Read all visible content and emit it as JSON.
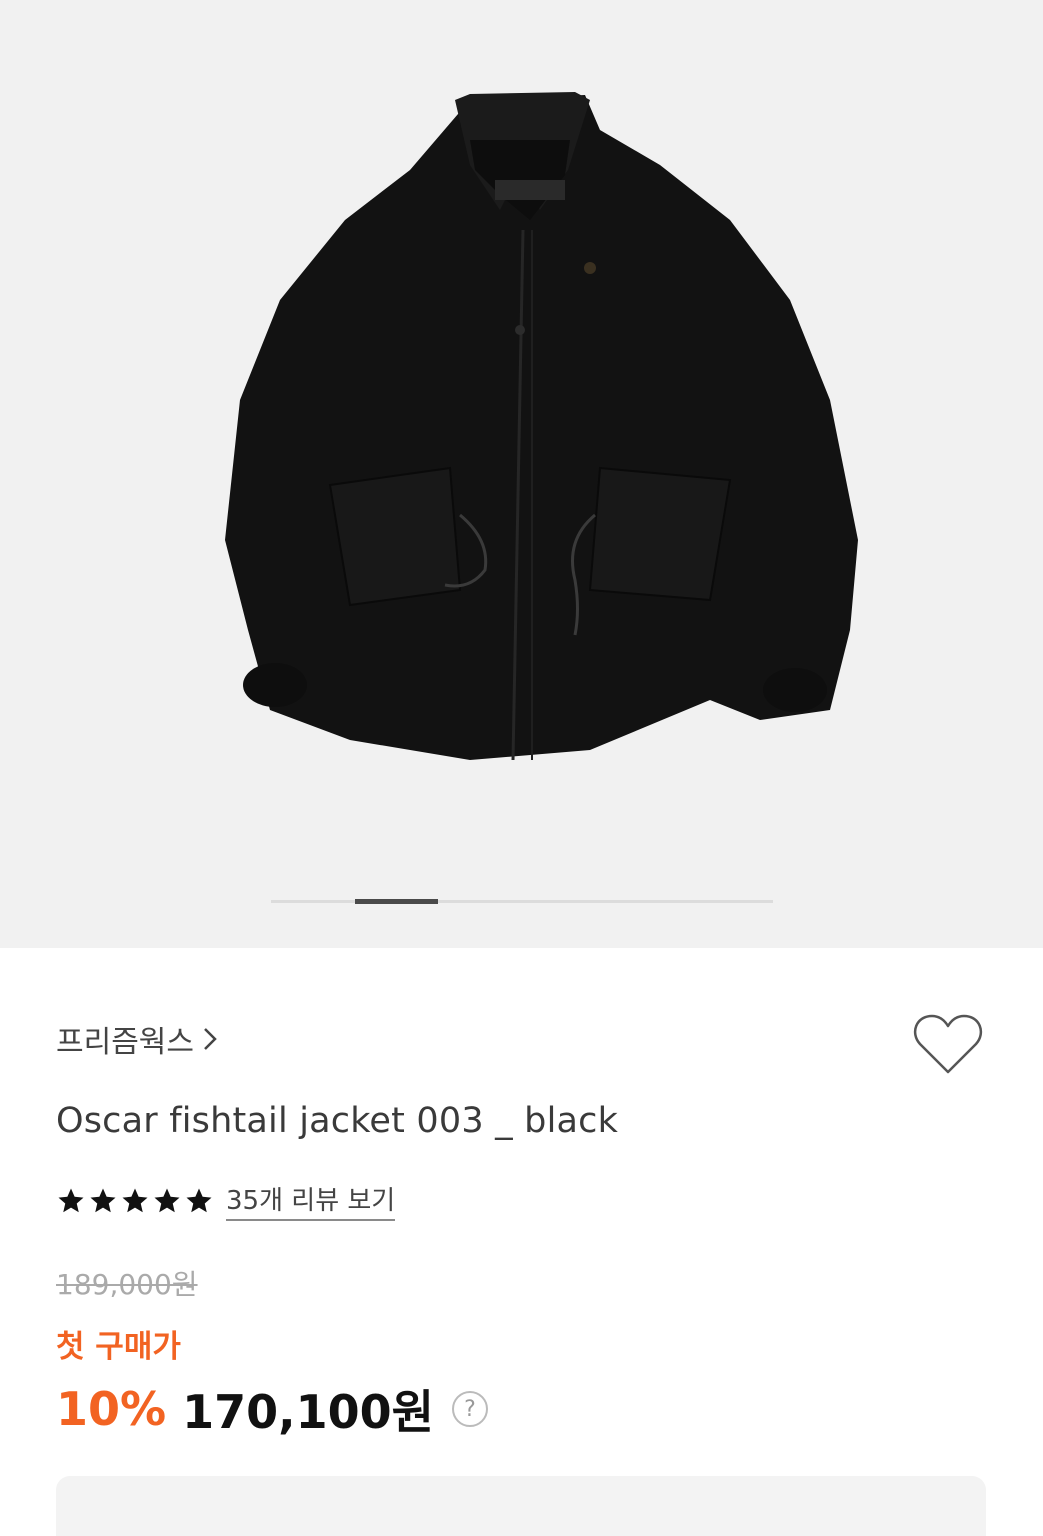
{
  "gallery": {
    "image_label": "Oscar fishtail jacket 003 _ black",
    "slide_current": 2,
    "slide_total": 6
  },
  "product": {
    "brand": "프리즘웍스",
    "title": "Oscar fishtail jacket 003 _ black",
    "rating_stars": 5,
    "review_link": "35개 리뷰 보기",
    "original_price": "189,000원",
    "first_purchase_label": "첫 구매가",
    "discount": "10%",
    "sale_price": "170,100원",
    "help_symbol": "?"
  },
  "colors": {
    "accent": "#f26322",
    "gallery_bg": "#f1f1f1",
    "star": "#111111"
  },
  "icons": {
    "brand_arrow": "chevron-right-icon",
    "wishlist": "heart-outline-icon",
    "rating": "star-icon",
    "help": "question-circle-icon"
  }
}
